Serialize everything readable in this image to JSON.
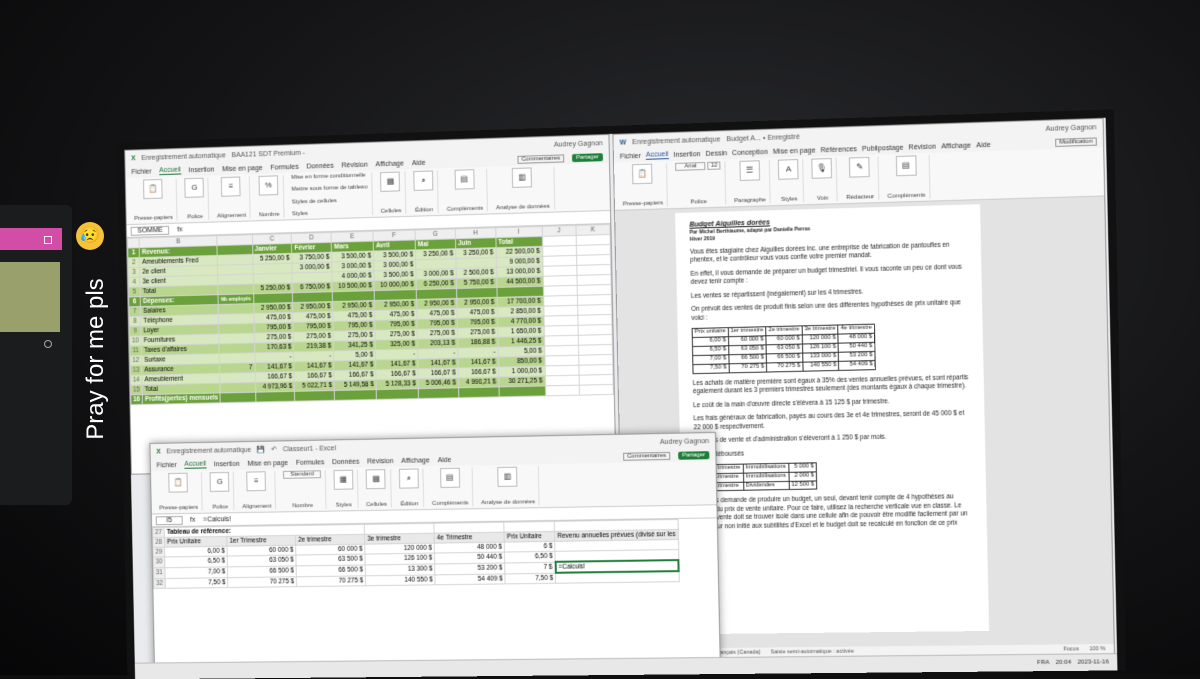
{
  "caption": {
    "text": "Pray for me pls",
    "emoji": "😥"
  },
  "excel_back": {
    "autosave": "Enregistrement automatique",
    "filename": "BAA121 SDT Premium -",
    "user": "Audrey Gagnon",
    "tabs": [
      "Fichier",
      "Accueil",
      "Insertion",
      "Mise en page",
      "Formules",
      "Données",
      "Révision",
      "Affichage",
      "Aide"
    ],
    "comments": "Commentaires",
    "share": "Partager",
    "groups": [
      "Presse-papiers",
      "Police",
      "Alignement",
      "Nombre",
      "Styles",
      "Cellules",
      "Édition",
      "Compléments",
      "Analyse de données"
    ],
    "styles_items": [
      "Mise en forme conditionnelle",
      "Mettre sous forme de tableau",
      "Styles de cellules"
    ],
    "namebox": "SOMME",
    "fx": "fx",
    "col_headers": [
      "A",
      "B",
      "C",
      "D",
      "E",
      "F",
      "G",
      "H",
      "I",
      "J",
      "K"
    ],
    "months": [
      "Janvier",
      "Février",
      "Mars",
      "Avril",
      "Mai",
      "Juin",
      "Total"
    ],
    "revenus_label": "Revenus:",
    "revenus": [
      {
        "label": "Ameublements Fred",
        "vals": [
          "5 250,00 $",
          "3 750,00 $",
          "3 500,00 $",
          "3 500,00 $",
          "3 250,00 $",
          "3 250,00 $",
          "22 500,00 $"
        ]
      },
      {
        "label": "2e client",
        "vals": [
          "",
          "3 000,00 $",
          "3 000,00 $",
          "3 000,00 $",
          "",
          "",
          "9 000,00 $"
        ]
      },
      {
        "label": "3e client",
        "vals": [
          "",
          "",
          "4 000,00 $",
          "3 500,00 $",
          "3 000,00 $",
          "2 500,00 $",
          "13 000,00 $"
        ]
      }
    ],
    "total_label": "Total",
    "revenus_total": [
      "5 250,00 $",
      "6 750,00 $",
      "10 500,00 $",
      "10 000,00 $",
      "6 250,00 $",
      "5 750,00 $",
      "44 500,00 $"
    ],
    "depenses_label": "Dépenses:",
    "nb_employes": "Nb employés",
    "depenses": [
      {
        "label": "Salaires",
        "nb": "",
        "vals": [
          "2 950,00 $",
          "2 950,00 $",
          "2 950,00 $",
          "2 950,00 $",
          "2 950,00 $",
          "2 950,00 $",
          "17 700,00 $"
        ]
      },
      {
        "label": "Téléphone",
        "nb": "",
        "vals": [
          "475,00 $",
          "475,00 $",
          "475,00 $",
          "475,00 $",
          "475,00 $",
          "475,00 $",
          "2 850,00 $"
        ]
      },
      {
        "label": "Loyer",
        "nb": "",
        "vals": [
          "795,00 $",
          "795,00 $",
          "795,00 $",
          "795,00 $",
          "795,00 $",
          "795,00 $",
          "4 770,00 $"
        ]
      },
      {
        "label": "Fournitures",
        "nb": "",
        "vals": [
          "275,00 $",
          "275,00 $",
          "275,00 $",
          "275,00 $",
          "275,00 $",
          "275,00 $",
          "1 650,00 $"
        ]
      },
      {
        "label": "Taxes d'affaires",
        "nb": "",
        "vals": [
          "170,63 $",
          "219,38 $",
          "341,25 $",
          "325,00 $",
          "203,13 $",
          "186,88 $",
          "1 446,25 $"
        ]
      },
      {
        "label": "Surtaxe",
        "nb": "",
        "vals": [
          "-",
          "-",
          "5,00 $",
          "-",
          "-",
          "-",
          "5,00 $"
        ]
      },
      {
        "label": "Assurance",
        "nb": "7",
        "vals": [
          "141,67 $",
          "141,67 $",
          "141,67 $",
          "141,67 $",
          "141,67 $",
          "141,67 $",
          "850,00 $"
        ]
      },
      {
        "label": "Ameublement",
        "nb": "",
        "vals": [
          "166,67 $",
          "166,67 $",
          "166,67 $",
          "166,67 $",
          "166,67 $",
          "166,67 $",
          "1 000,00 $"
        ]
      }
    ],
    "depenses_total": [
      "4 973,96 $",
      "5 022,71 $",
      "5 149,58 $",
      "5 128,33 $",
      "5 006,46 $",
      "4 990,21 $",
      "30 271,25 $"
    ],
    "profits_label": "Profits(pertes) mensuels"
  },
  "excel_front": {
    "autosave": "Enregistrement automatique",
    "filename": "Classeur1 - Excel",
    "user": "Audrey Gagnon",
    "tabs": [
      "Fichier",
      "Accueil",
      "Insertion",
      "Mise en page",
      "Formules",
      "Données",
      "Révision",
      "Affichage",
      "Aide"
    ],
    "comments": "Commentaires",
    "share": "Partager",
    "groups": [
      "Presse-papiers",
      "Police",
      "Alignement",
      "Nombre",
      "Styles",
      "Cellules",
      "Édition",
      "Compléments",
      "Analyse de données"
    ],
    "number_format": "Standard",
    "namebox": "I5",
    "formula": "=Calculs!",
    "ref_title": "Tableau de référence:",
    "ref_headers": [
      "Prix Unitaire",
      "1er Trimestre",
      "2e trimestre",
      "3e trimestre",
      "4e Trimestre",
      "Prix Unitaire",
      "Revenu annuelles prévues (divisé sur les"
    ],
    "ref_rows": [
      [
        "6,00 $",
        "60 000 $",
        "60 000 $",
        "120 000 $",
        "48 000 $",
        "6 $",
        ""
      ],
      [
        "6,50 $",
        "63 050 $",
        "63 500 $",
        "126 100 $",
        "50 440 $",
        "6,50 $",
        ""
      ],
      [
        "7,00 $",
        "66 500 $",
        "66 500 $",
        "13 300 $",
        "53 200 $",
        "7 $",
        "=Calculs!"
      ],
      [
        "7,50 $",
        "70 275 $",
        "70 275 $",
        "140 550 $",
        "54 409 $",
        "7,50 $",
        ""
      ]
    ],
    "row_numbers": [
      "16",
      "17",
      "18",
      "19",
      "20",
      "21",
      "22",
      "23",
      "24",
      "25",
      "26",
      "27",
      "28",
      "29",
      "30",
      "31",
      "32"
    ]
  },
  "word": {
    "autosave": "Enregistrement automatique",
    "filename": "Budget A... • Enregistré",
    "user": "Audrey Gagnon",
    "tabs": [
      "Fichier",
      "Accueil",
      "Insertion",
      "Dessin",
      "Conception",
      "Mise en page",
      "Références",
      "Publipostage",
      "Révision",
      "Affichage",
      "Aide"
    ],
    "mode": "Modification",
    "font": "Arial",
    "size": "12",
    "groups": [
      "Presse-papiers",
      "Police",
      "Paragraphe",
      "Styles",
      "Voix",
      "Rédacteur",
      "Compléments"
    ],
    "ribbon_buttons": [
      "Styles",
      "Édition",
      "Dicter",
      "Rédacteur",
      "Compléments"
    ],
    "doc_title": "Budget Aiguilles dorées",
    "byline": "Par Michel Berthiaume, adapté par Danielle Perras",
    "season": "Hiver 2019",
    "paragraphs": [
      "Vous êtes stagiaire chez Aiguilles dorées inc. une entreprise de fabrication de pantoufles en phentex, et le contrôleur vous vous confie votre premier mandat.",
      "En effet, il vous demande de préparer un budget trimestriel. Il vous raconte un peu ce dont vous devez tenir compte :",
      "Les ventes se répartissent (inégalement) sur les 4 trimestres.",
      "On prévoit des ventes de produit finis selon une des différentes hypothèses de prix unitaire que voici :"
    ],
    "table_headers": [
      "Prix unitaire",
      "1er trimestre",
      "2e trimestre",
      "3e trimestre",
      "4e trimestre"
    ],
    "table_rows": [
      [
        "6,00 $",
        "60 000 $",
        "60 000 $",
        "120 000 $",
        "48 000 $"
      ],
      [
        "6,50 $",
        "63 050 $",
        "63 050 $",
        "126 100 $",
        "50 440 $"
      ],
      [
        "7,00 $",
        "66 500 $",
        "66 500 $",
        "133 000 $",
        "53 200 $"
      ],
      [
        "7,50 $",
        "70 275 $",
        "70 275 $",
        "140 550 $",
        "54 409 $"
      ]
    ],
    "paragraphs2": [
      "Les achats de matière première sont égaux à 35% des ventes annuelles prévues, et sont répartis également durant les 3 premiers trimestres seulement (des montants égaux à chaque trimestre).",
      "Le coût de la main d'œuvre directe s'élèvera à 15 125 $ par trimestre.",
      "Les frais généraux de fabrication, payés au cours des 3e et 4e trimestres, seront de 45 000 $ et 22 000 $ respectivement.",
      "Les frais de vente et d'administration s'élèveront à 1 250 $ par mois."
    ],
    "autres": "Autres déboursés",
    "autres_rows": [
      [
        "1er trimestre",
        "Immobilisations",
        "5 000 $"
      ],
      [
        "2e trimestre",
        "Immobilisations",
        "2 000 $"
      ],
      [
        "4e trimestre",
        "Dividendes",
        "12 500 $"
      ]
    ],
    "closing": "On vous demande de produire un budget, un seul, devant tenir compte de 4 hypothèses au niveau du prix de vente unitaire. Pour ce faire, utilisez la recherche verticale vue en classe. Le prix de vente doit se trouver isolé dans une cellule afin de pouvoir être modifié facilement par un utilisateur non initié aux subtilités d'Excel et le budget doit se recalculé en fonction de ce prix",
    "status_lang": "Français (Canada)",
    "status_predict": "Saisie semi-automatique : activée",
    "focus": "Focus",
    "zoom": "100 %"
  },
  "taskbar": {
    "lang": "FRA",
    "time": "20:04",
    "date": "2023-11-16"
  }
}
